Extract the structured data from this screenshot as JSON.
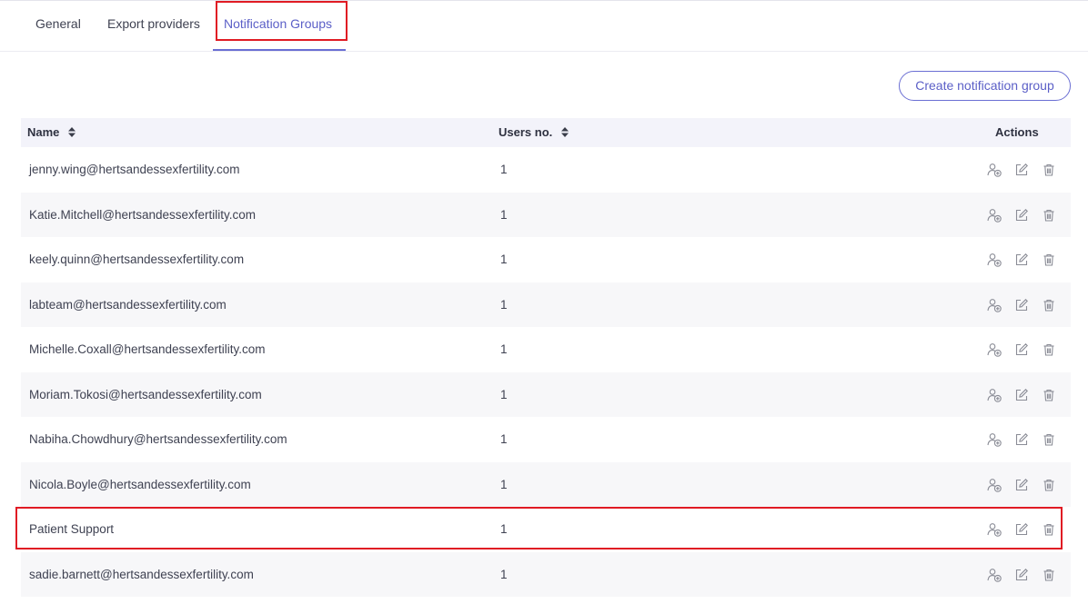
{
  "tabs": [
    {
      "label": "General"
    },
    {
      "label": "Export providers"
    },
    {
      "label": "Notification Groups"
    }
  ],
  "create_button_label": "Create notification group",
  "table": {
    "headers": {
      "name": "Name",
      "users": "Users no.",
      "actions": "Actions"
    },
    "rows": [
      {
        "name": "jenny.wing@hertsandessexfertility.com",
        "users": "1"
      },
      {
        "name": "Katie.Mitchell@hertsandessexfertility.com",
        "users": "1"
      },
      {
        "name": "keely.quinn@hertsandessexfertility.com",
        "users": "1"
      },
      {
        "name": "labteam@hertsandessexfertility.com",
        "users": "1"
      },
      {
        "name": "Michelle.Coxall@hertsandessexfertility.com",
        "users": "1"
      },
      {
        "name": "Moriam.Tokosi@hertsandessexfertility.com",
        "users": "1"
      },
      {
        "name": "Nabiha.Chowdhury@hertsandessexfertility.com",
        "users": "1"
      },
      {
        "name": "Nicola.Boyle@hertsandessexfertility.com",
        "users": "1"
      },
      {
        "name": "Patient Support",
        "users": "1"
      },
      {
        "name": "sadie.barnett@hertsandessexfertility.com",
        "users": "1"
      }
    ]
  },
  "icons": {
    "sort": "sort-icon",
    "add_user": "add-user-icon",
    "edit": "edit-icon",
    "delete": "trash-icon"
  },
  "colors": {
    "accent": "#5b5fc7",
    "highlight": "#e01b24",
    "header_bg": "#f3f3fa",
    "row_alt_bg": "#f7f7f9"
  }
}
